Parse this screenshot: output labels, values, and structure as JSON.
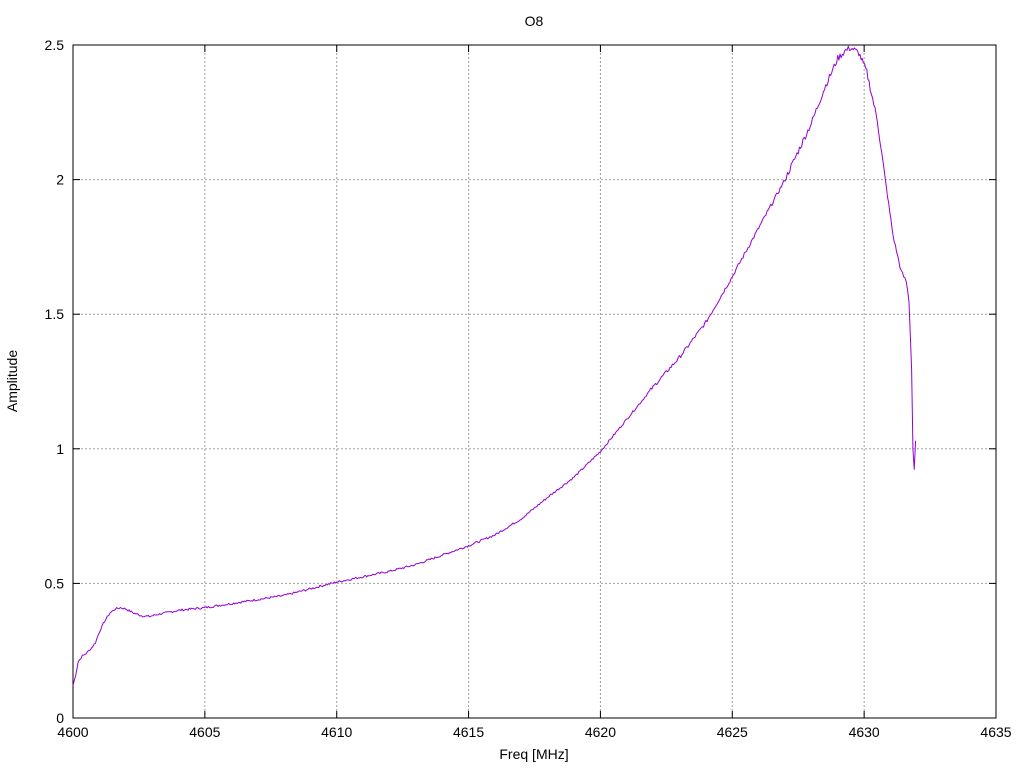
{
  "chart_data": {
    "type": "line",
    "title": "O8",
    "xlabel": "Freq [MHz]",
    "ylabel": "Amplitude",
    "xlim": [
      4600,
      4635
    ],
    "ylim": [
      0,
      2.5
    ],
    "x_ticks": [
      "4600",
      "4605",
      "4610",
      "4615",
      "4620",
      "4625",
      "4630",
      "4635"
    ],
    "y_ticks": [
      "0",
      "0.5",
      "1",
      "1.5",
      "2",
      "2.5"
    ],
    "grid": true,
    "line_color": "#9400d3",
    "series": [
      {
        "name": "",
        "points": [
          [
            4600.0,
            0.12
          ],
          [
            4600.1,
            0.16
          ],
          [
            4600.2,
            0.21
          ],
          [
            4600.35,
            0.23
          ],
          [
            4600.5,
            0.24
          ],
          [
            4600.7,
            0.26
          ],
          [
            4600.85,
            0.28
          ],
          [
            4601.0,
            0.32
          ],
          [
            4601.2,
            0.36
          ],
          [
            4601.4,
            0.39
          ],
          [
            4601.6,
            0.405
          ],
          [
            4601.8,
            0.41
          ],
          [
            4602.0,
            0.405
          ],
          [
            4602.3,
            0.39
          ],
          [
            4602.6,
            0.38
          ],
          [
            4602.9,
            0.377
          ],
          [
            4603.2,
            0.385
          ],
          [
            4603.5,
            0.39
          ],
          [
            4604.0,
            0.4
          ],
          [
            4605.0,
            0.41
          ],
          [
            4606.0,
            0.425
          ],
          [
            4607.0,
            0.44
          ],
          [
            4608.0,
            0.455
          ],
          [
            4609.0,
            0.48
          ],
          [
            4610.0,
            0.505
          ],
          [
            4611.0,
            0.525
          ],
          [
            4612.0,
            0.545
          ],
          [
            4613.0,
            0.57
          ],
          [
            4614.0,
            0.605
          ],
          [
            4615.0,
            0.64
          ],
          [
            4616.0,
            0.68
          ],
          [
            4617.0,
            0.74
          ],
          [
            4618.0,
            0.82
          ],
          [
            4619.0,
            0.895
          ],
          [
            4620.0,
            0.99
          ],
          [
            4621.0,
            1.11
          ],
          [
            4622.0,
            1.23
          ],
          [
            4623.0,
            1.34
          ],
          [
            4624.0,
            1.47
          ],
          [
            4625.0,
            1.64
          ],
          [
            4626.0,
            1.82
          ],
          [
            4627.0,
            2.0
          ],
          [
            4628.0,
            2.21
          ],
          [
            4628.5,
            2.34
          ],
          [
            4629.0,
            2.45
          ],
          [
            4629.3,
            2.48
          ],
          [
            4629.5,
            2.49
          ],
          [
            4629.8,
            2.47
          ],
          [
            4630.1,
            2.4
          ],
          [
            4630.5,
            2.22
          ],
          [
            4630.8,
            2.0
          ],
          [
            4631.1,
            1.79
          ],
          [
            4631.4,
            1.66
          ],
          [
            4631.6,
            1.62
          ],
          [
            4631.7,
            1.55
          ],
          [
            4631.8,
            1.3
          ],
          [
            4631.85,
            1.0
          ],
          [
            4631.9,
            0.92
          ],
          [
            4631.95,
            1.03
          ]
        ]
      }
    ]
  }
}
